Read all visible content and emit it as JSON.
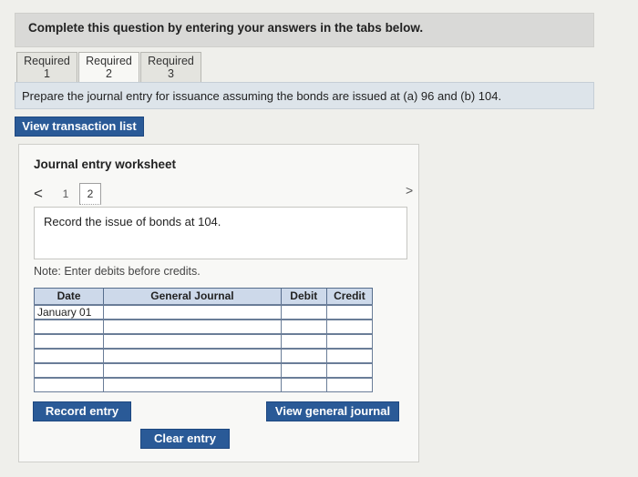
{
  "banner": {
    "text": "Complete this question by entering your answers in the tabs below."
  },
  "tabs": [
    {
      "line1": "Required",
      "line2": "1",
      "active": false
    },
    {
      "line1": "Required",
      "line2": "2",
      "active": true
    },
    {
      "line1": "Required",
      "line2": "3",
      "active": false
    }
  ],
  "instruction": "Prepare the journal entry for issuance assuming the bonds are issued at (a) 96 and (b) 104.",
  "view_transaction_list": "View transaction list",
  "worksheet": {
    "title": "Journal entry worksheet",
    "pager": {
      "prev": "<",
      "page1": "1",
      "page2": "2",
      "next": ">"
    },
    "record_text": "Record the issue of bonds at 104.",
    "note": "Note: Enter debits before credits."
  },
  "table": {
    "headers": {
      "date": "Date",
      "general_journal": "General Journal",
      "debit": "Debit",
      "credit": "Credit"
    },
    "rows": [
      {
        "date": "January 01",
        "account": "",
        "debit": "",
        "credit": ""
      },
      {
        "date": "",
        "account": "",
        "debit": "",
        "credit": ""
      },
      {
        "date": "",
        "account": "",
        "debit": "",
        "credit": ""
      },
      {
        "date": "",
        "account": "",
        "debit": "",
        "credit": ""
      },
      {
        "date": "",
        "account": "",
        "debit": "",
        "credit": ""
      },
      {
        "date": "",
        "account": "",
        "debit": "",
        "credit": ""
      }
    ]
  },
  "buttons": {
    "record_entry": "Record entry",
    "view_general_journal": "View general journal",
    "clear_entry": "Clear entry"
  },
  "colors": {
    "accent_button": "#2a5a97",
    "table_header": "#cdd9ea",
    "instruction_bar": "#dde4ea"
  }
}
